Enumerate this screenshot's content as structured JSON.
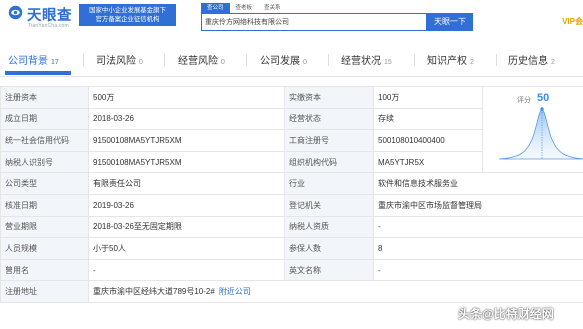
{
  "header": {
    "logo_name": "天眼查",
    "logo_domain": "TianYanCha.com",
    "slogan_line1": "国家中小企业发展基金旗下",
    "slogan_line2": "官方备案企业征信机构",
    "search_tabs": [
      {
        "label": "查公司",
        "active": true
      },
      {
        "label": "查老板",
        "active": false
      },
      {
        "label": "查关系",
        "active": false
      }
    ],
    "search_value": "重庆伶方网络科技有限公司",
    "search_button": "天眼一下",
    "vip": "VIP会"
  },
  "nav": {
    "tabs": [
      {
        "label": "公司背景",
        "count": "17",
        "active": true
      },
      {
        "label": "司法风险",
        "count": "0",
        "active": false
      },
      {
        "label": "经营风险",
        "count": "0",
        "active": false
      },
      {
        "label": "公司发展",
        "count": "0",
        "active": false
      },
      {
        "label": "经营状况",
        "count": "15",
        "active": false
      },
      {
        "label": "知识产权",
        "count": "2",
        "active": false
      },
      {
        "label": "历史信息",
        "count": "2",
        "active": false
      }
    ]
  },
  "info": {
    "rows": [
      {
        "k1": "注册资本",
        "v1": "500万",
        "k2": "实缴资本",
        "v2": "100万"
      },
      {
        "k1": "成立日期",
        "v1": "2018-03-26",
        "k2": "经营状态",
        "v2": "存续"
      },
      {
        "k1": "统一社会信用代码",
        "v1": "91500108MA5YTJR5XM",
        "k2": "工商注册号",
        "v2": "500108010400400"
      },
      {
        "k1": "纳税人识别号",
        "v1": "91500108MA5YTJR5XM",
        "k2": "组织机构代码",
        "v2": "MA5YTJR5X"
      },
      {
        "k1": "公司类型",
        "v1": "有限责任公司",
        "k2": "行业",
        "v2": "软件和信息技术服务业"
      },
      {
        "k1": "核准日期",
        "v1": "2019-03-26",
        "k2": "登记机关",
        "v2": "重庆市渝中区市场监督管理局"
      },
      {
        "k1": "营业期限",
        "v1": "2018-03-26至无固定期限",
        "k2": "纳税人资质",
        "v2": "-"
      },
      {
        "k1": "人员规模",
        "v1": "小于50人",
        "k2": "参保人数",
        "v2": "8"
      },
      {
        "k1": "曾用名",
        "v1": "-",
        "k2": "英文名称",
        "v2": "-"
      }
    ],
    "address_label": "注册地址",
    "address_value": "重庆市渝中区经纬大道789号10-2#",
    "address_link": "附近公司"
  },
  "score": {
    "label": "评分",
    "value": "50"
  },
  "watermark": {
    "text": "头条@比特财经网"
  },
  "colors": {
    "brand_blue": "#2f6fd6",
    "key_cell_bg": "#f2f5f9",
    "vip_gold": "#e7a300"
  }
}
